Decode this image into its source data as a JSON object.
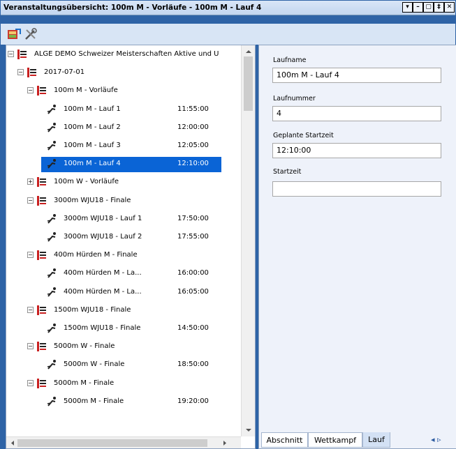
{
  "window": {
    "title": "Veranstaltungsübersicht: 100m M - Vorläufe - 100m M - Lauf 4",
    "buttons": [
      "▾",
      "–",
      "▢",
      "‡",
      "✕"
    ]
  },
  "toolbar": {
    "icons": [
      "export-icon",
      "settings-tools-icon"
    ]
  },
  "tree": {
    "rows": [
      {
        "label": "ALGE DEMO Schweizer Meisterschaften Aktive und U",
        "time": "",
        "level": 0,
        "kind": "root",
        "toggle": "−"
      },
      {
        "label": "2017-07-01",
        "time": "",
        "level": 1,
        "kind": "group",
        "toggle": "−"
      },
      {
        "label": "100m M - Vorläufe",
        "time": "",
        "level": 2,
        "kind": "group",
        "toggle": "−"
      },
      {
        "label": "100m M - Lauf 1",
        "time": "11:55:00",
        "level": 3,
        "kind": "run"
      },
      {
        "label": "100m M - Lauf 2",
        "time": "12:00:00",
        "level": 3,
        "kind": "run"
      },
      {
        "label": "100m M - Lauf 3",
        "time": "12:05:00",
        "level": 3,
        "kind": "run"
      },
      {
        "label": "100m M - Lauf 4",
        "time": "12:10:00",
        "level": 3,
        "kind": "run",
        "selected": true
      },
      {
        "label": "100m W - Vorläufe",
        "time": "",
        "level": 2,
        "kind": "group",
        "toggle": "+"
      },
      {
        "label": "3000m WJU18 - Finale",
        "time": "",
        "level": 2,
        "kind": "group",
        "toggle": "−"
      },
      {
        "label": "3000m WJU18 - Lauf 1",
        "time": "17:50:00",
        "level": 3,
        "kind": "run"
      },
      {
        "label": "3000m WJU18 - Lauf 2",
        "time": "17:55:00",
        "level": 3,
        "kind": "run"
      },
      {
        "label": "400m Hürden M - Finale",
        "time": "",
        "level": 2,
        "kind": "group",
        "toggle": "−"
      },
      {
        "label": "400m Hürden M - La...",
        "time": "16:00:00",
        "level": 3,
        "kind": "run"
      },
      {
        "label": "400m Hürden M - La...",
        "time": "16:05:00",
        "level": 3,
        "kind": "run"
      },
      {
        "label": "1500m WJU18 - Finale",
        "time": "",
        "level": 2,
        "kind": "group",
        "toggle": "−"
      },
      {
        "label": "1500m WJU18 - Finale",
        "time": "14:50:00",
        "level": 3,
        "kind": "run"
      },
      {
        "label": "5000m W - Finale",
        "time": "",
        "level": 2,
        "kind": "group",
        "toggle": "−"
      },
      {
        "label": "5000m W - Finale",
        "time": "18:50:00",
        "level": 3,
        "kind": "run"
      },
      {
        "label": "5000m M - Finale",
        "time": "",
        "level": 2,
        "kind": "group",
        "toggle": "−"
      },
      {
        "label": "5000m M - Finale",
        "time": "19:20:00",
        "level": 3,
        "kind": "run"
      }
    ]
  },
  "form": {
    "laufname_label": "Laufname",
    "laufname_value": "100m M - Lauf 4",
    "laufnummer_label": "Laufnummer",
    "laufnummer_value": "4",
    "geplante_label": "Geplante Startzeit",
    "geplante_value": "12:10:00",
    "startzeit_label": "Startzeit",
    "startzeit_value": ""
  },
  "tabs": {
    "abschnitt": "Abschnitt",
    "wettkampf": "Wettkampf",
    "lauf": "Lauf",
    "nav": "◂ ▹"
  },
  "colors": {
    "frame": "#2e63a6",
    "selection": "#0a64d6"
  }
}
